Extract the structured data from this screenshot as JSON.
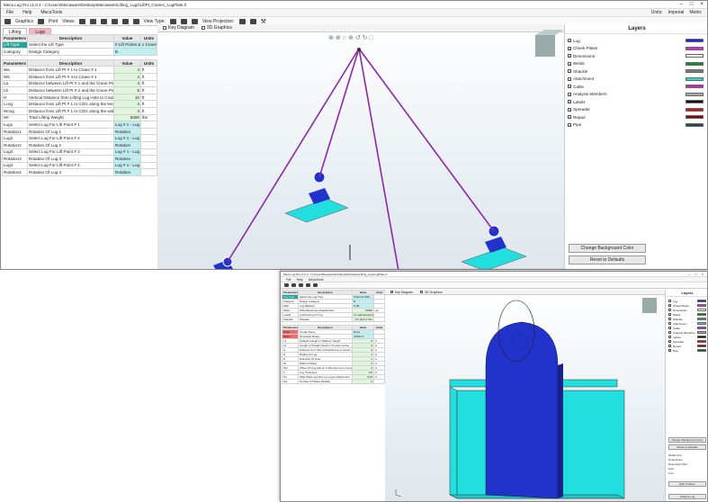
{
  "w1": {
    "title": "Meca Lug Pro v1.0.4 - C:\\Users\\Mecaware\\Desktop\\Mecaware\\Lifting_Lugs\\LiftPt_Crane1_LugPlate.lt",
    "units_label": "Units:",
    "units_imperial": "Imperial",
    "units_metric": "Metric",
    "menu": [
      "File",
      "Help",
      "MecaTools"
    ],
    "toolbar": {
      "graphics": "Graphics",
      "print": "Print",
      "views": "Views",
      "view_type": "View Type:",
      "view_projection": "View Projection:"
    },
    "tabs": [
      "Lifting",
      "Lugs"
    ],
    "top_headers": [
      "Parameters",
      "Description",
      "Value",
      "Units"
    ],
    "top_rows": [
      {
        "p": "Lift Type:",
        "d": "Select the Lift Type",
        "v": "# Lift Points & 1 Crane"
      },
      {
        "p": "Category",
        "d": "Design Category",
        "v": "B"
      }
    ],
    "headers": [
      "Parameters",
      "Description",
      "Value",
      "Units"
    ],
    "rows": [
      {
        "p": "Wa",
        "d": "Distance from Lift Pt # 1 to Crane # 1",
        "v": "4",
        "u": "ft"
      },
      {
        "p": "Wb",
        "d": "Distance from Lift Pt # 4 to Crane # 1",
        "v": "4",
        "u": "ft"
      },
      {
        "p": "La",
        "d": "Distance between Lift Pt # 1 and the Crane Pick Point",
        "v": "4",
        "u": "ft"
      },
      {
        "p": "Lb",
        "d": "Distance between Lift Pt # 2 and the Crane Pick Point",
        "v": "5",
        "u": "ft"
      },
      {
        "p": "H",
        "d": "Vertical Distance from Lifting Lug Hole to Crane(s)",
        "v": "10",
        "u": "ft"
      },
      {
        "p": "Lcog",
        "d": "Distance from Lift Pt # 1 to COG along the length",
        "v": "4",
        "u": "ft"
      },
      {
        "p": "Wcog",
        "d": "Distance from Lift Pt # 1 to COG along the width",
        "v": "4",
        "u": "ft"
      },
      {
        "p": "Wt",
        "d": "Total Lifting Weight",
        "v": "5000",
        "u": "lbs"
      },
      {
        "p": "Lug1",
        "d": "Select Lug For Lift Point # 1",
        "v": "Lug # 1 - Lug",
        "u": ""
      },
      {
        "p": "Rotation1",
        "d": "Rotation Of Lug 1",
        "v": "Rotation",
        "u": ""
      },
      {
        "p": "Lug2",
        "d": "Select Lug For Lift Point # 2",
        "v": "Lug # 1 - Lug",
        "u": ""
      },
      {
        "p": "Rotation2",
        "d": "Rotation Of Lug 2",
        "v": "Rotation",
        "u": ""
      },
      {
        "p": "Lug3",
        "d": "Select Lug For Lift Point # 3",
        "v": "Lug # 1 - Lug",
        "u": ""
      },
      {
        "p": "Rotation3",
        "d": "Rotation Of Lug 3",
        "v": "Rotation",
        "u": ""
      },
      {
        "p": "Lug4",
        "d": "Select Lug For Lift Point # 4",
        "v": "Lug # 1 - Lug",
        "u": ""
      },
      {
        "p": "Rotation4",
        "d": "Rotation Of Lug 4",
        "v": "Rotation",
        "u": ""
      }
    ],
    "view_tabs": [
      "Key Diagram",
      "3D Graphics"
    ],
    "layers_title": "Layers",
    "layers": [
      {
        "name": "Lug",
        "color": "#2222cc"
      },
      {
        "name": "Cheek Plates",
        "color": "#e020e0"
      },
      {
        "name": "Dimensions",
        "color": "#ffffff"
      },
      {
        "name": "Welds",
        "color": "#1a8a2a"
      },
      {
        "name": "Shackle",
        "color": "#7a7a7a"
      },
      {
        "name": "Attachment",
        "color": "#22dede"
      },
      {
        "name": "Cable",
        "color": "#cc22cc"
      },
      {
        "name": "Analysis Members",
        "color": "#aaaaaa"
      },
      {
        "name": "Labels",
        "color": "#111111"
      },
      {
        "name": "Spreader",
        "color": "#cc1111"
      },
      {
        "name": "Repad",
        "color": "#990000"
      },
      {
        "name": "Pipe",
        "color": "#2a4a4a"
      }
    ],
    "btn_bg": "Change Background Color",
    "btn_reset": "Reset to Defaults"
  },
  "w2": {
    "title": "Meca Lug Pro v1.0.4 - C:\\Users\\Mecaware\\Desktop\\Mecaware\\Lifting_Lugs\\LugPlate.lt",
    "menu": [
      "File",
      "Help",
      "MecaTools"
    ],
    "headers": [
      "Parameters",
      "Description",
      "Value",
      "Units"
    ],
    "top_rows": [
      {
        "p": "Lug Type",
        "d": "Select the Lug Type",
        "v": "Channel Web",
        "u": ""
      },
      {
        "p": "Category",
        "d": "Design Category",
        "v": "B",
        "u": ""
      },
      {
        "p": "Matl",
        "d": "Lug Material",
        "v": "A-36",
        "u": ""
      },
      {
        "p": "Weld",
        "d": "Weld Electrode Classification",
        "v": "70000",
        "u": "psi"
      },
      {
        "p": "Load1",
        "d": "Load acting on Lug",
        "v": "5 Loads Entered",
        "u": ""
      },
      {
        "p": "Shackle",
        "d": "Shackle",
        "v": "0.5 (1/2) 2 Ton",
        "u": ""
      }
    ],
    "rows": [
      {
        "p": "Chan",
        "d": "Create Piece",
        "v": "None",
        "u": ""
      },
      {
        "p": "Beam",
        "d": "Structural Shape",
        "v": "C8X11.5",
        "u": ""
      },
      {
        "p": "L1",
        "d": "Straight Length or Stiffener Height",
        "v": "6",
        "u": "in"
      },
      {
        "p": "L2",
        "d": "Length of Straight Section To Hole Center",
        "v": "4",
        "u": "in"
      },
      {
        "p": "H",
        "d": "Distance from Top of Attachment to Center of Hole",
        "v": "6",
        "u": "in"
      },
      {
        "p": "R",
        "d": "Radius Of Lug",
        "v": "2",
        "u": "in"
      },
      {
        "p": "D",
        "d": "Diameter Of Hole",
        "v": "1",
        "u": "in"
      },
      {
        "p": "W",
        "d": "Width Of Base",
        "v": "4",
        "u": "in"
      },
      {
        "p": "W2",
        "d": "Offset Of Lug Hole In X Direction from Centerline",
        "v": "0",
        "u": "in"
      },
      {
        "p": "T",
        "d": "Lug Thickness",
        "v": "0.5",
        "u": "in"
      },
      {
        "p": "Tw",
        "d": "Fillet Weld Leg Size for Lug to Attachment",
        "v": "0.25",
        "u": "in"
      },
      {
        "p": "Nw",
        "d": "Number Of Sides Welded",
        "v": "2",
        "u": ""
      }
    ],
    "view_tabs": [
      "Key Diagram",
      "3D Graphics"
    ],
    "layers_title": "Layers",
    "layers": [
      {
        "name": "Lug",
        "color": "#2222cc"
      },
      {
        "name": "Cheek Plates",
        "color": "#e020e0"
      },
      {
        "name": "Dimensions",
        "color": "#ffffff"
      },
      {
        "name": "Welds",
        "color": "#1a8a2a"
      },
      {
        "name": "Shackle",
        "color": "#7a7a7a"
      },
      {
        "name": "Attachment",
        "color": "#22dede"
      },
      {
        "name": "Cable",
        "color": "#cc22cc"
      },
      {
        "name": "Analysis Members",
        "color": "#aaaaaa"
      },
      {
        "name": "Labels",
        "color": "#111111"
      },
      {
        "name": "Spreader",
        "color": "#cc1111"
      },
      {
        "name": "Repad",
        "color": "#990000"
      },
      {
        "name": "Pipe",
        "color": "#2a4a4a"
      }
    ],
    "btn_bg": "Change Background Color",
    "btn_reset": "Reset to Defaults",
    "opts": [
      "Rotate Key",
      "Dimensions",
      "Dimension Size",
      "Font",
      "Line"
    ],
    "btn_fit": "Edit To Move",
    "btn_analyze": "Analyze Lug"
  }
}
